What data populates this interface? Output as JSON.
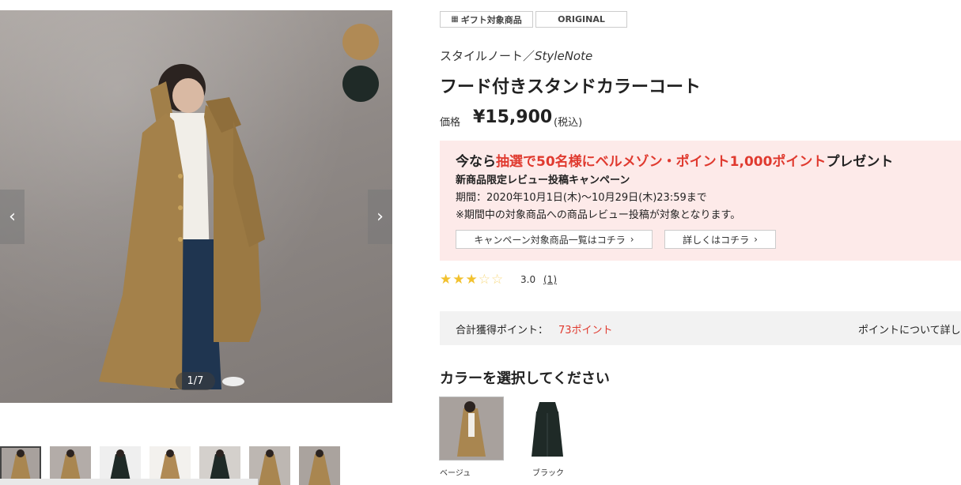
{
  "gallery": {
    "counter": "1/7",
    "prev_icon": "‹",
    "next_icon": "›",
    "swatches": [
      "#b08a55",
      "#1f2a27"
    ],
    "thumbnails": [
      {
        "color": "#a98650",
        "bg": "#a8a19d"
      },
      {
        "color": "#a98650",
        "bg": "#b3aca8"
      },
      {
        "color": "#1f2a27",
        "bg": "#efefef"
      },
      {
        "color": "#b08a55",
        "bg": "#f3f1ee"
      },
      {
        "color": "#1f2a27",
        "bg": "#d4d0cc"
      },
      {
        "color": "#a98650",
        "bg": "#bdb7b2"
      },
      {
        "color": "#a98650",
        "bg": "#aaa39e"
      }
    ]
  },
  "tags": {
    "gift": "ギフト対象商品",
    "original": "ORIGINAL"
  },
  "product": {
    "brand_ja": "スタイルノート／",
    "brand_en": "StyleNote",
    "title": "フード付きスタンドカラーコート",
    "price_label": "価格",
    "price": "¥15,900",
    "tax": "(税込)"
  },
  "campaign": {
    "headline_pre": "今なら",
    "headline_red": "抽選で50名様にベルメゾン・ポイント1,000ポイント",
    "headline_post": "プレゼント",
    "subtitle": "新商品限定レビュー投稿キャンペーン",
    "period": "期間：2020年10月1日(木)〜10月29日(木)23:59まで",
    "note": "※期間中の対象商品への商品レビュー投稿が対象となります。",
    "button_list": "キャンペーン対象商品一覧はコチラ",
    "button_detail": "詳しくはコチラ",
    "chevron": "›"
  },
  "rating": {
    "stars_on": "★★★",
    "stars_off": "☆☆",
    "value": "3.0",
    "count": "(1)"
  },
  "points": {
    "label": "合計獲得ポイント：",
    "value": "73ポイント",
    "link": "ポイントについて詳し"
  },
  "colors": {
    "heading": "カラーを選択してください",
    "options": [
      {
        "label": "ベージュ",
        "hex": "#a98650"
      },
      {
        "label": "ブラック",
        "hex": "#1f2a27"
      }
    ]
  }
}
